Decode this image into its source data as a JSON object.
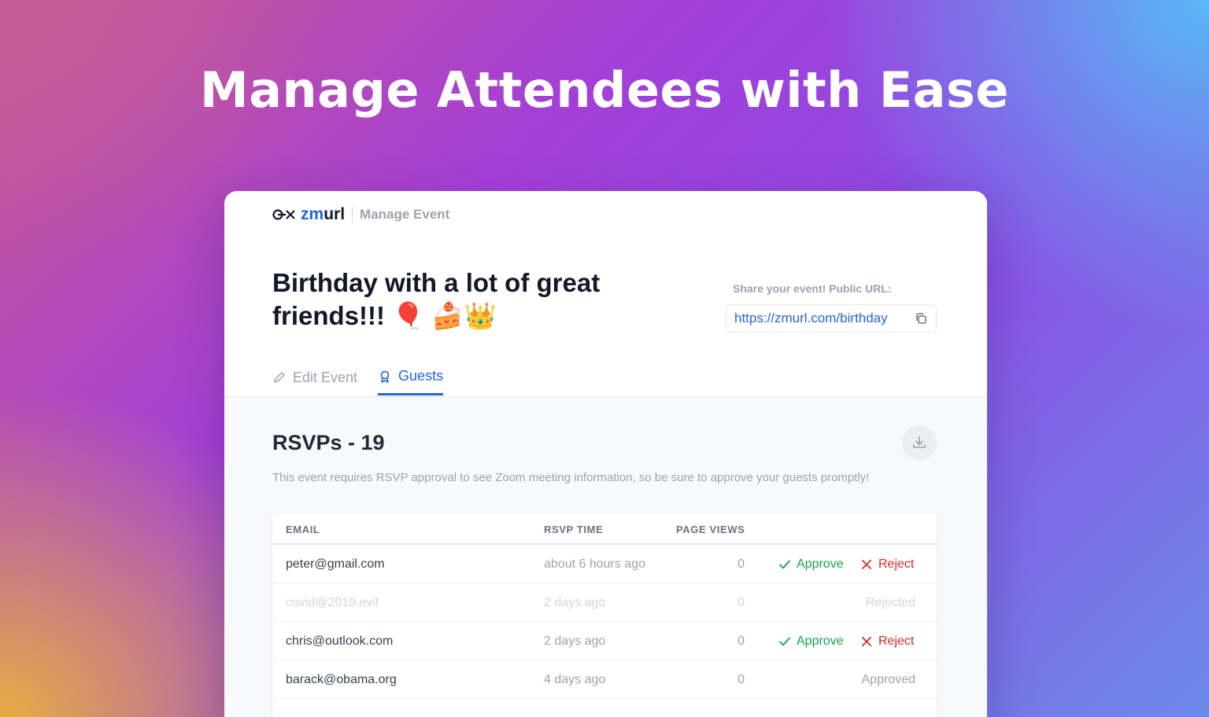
{
  "headline": "Manage Attendees with Ease",
  "app": {
    "logo_prefix": "zm",
    "logo_suffix": "url",
    "crumb": "Manage Event"
  },
  "event": {
    "title": "Birthday with a lot of great friends!!! 🎈 🍰👑",
    "share_label": "Share your event! Public URL:",
    "share_url": "https://zmurl.com/birthday"
  },
  "tabs": [
    {
      "label": "Edit Event",
      "icon": "pencil-icon",
      "active": false
    },
    {
      "label": "Guests",
      "icon": "badge-icon",
      "active": true
    }
  ],
  "rsvps": {
    "title": "RSVPs - 19",
    "note": "This event requires RSVP approval to see Zoom meeting information, so be sure to approve your guests promptly!",
    "columns": {
      "email": "EMAIL",
      "time": "RSVP TIME",
      "views": "PAGE VIEWS"
    },
    "approve_label": "Approve",
    "reject_label": "Reject",
    "rows": [
      {
        "email": "peter@gmail.com",
        "time": "about 6 hours ago",
        "views": "0",
        "status": ""
      },
      {
        "email": "covid@2019.evil",
        "time": "2 days ago",
        "views": "0",
        "status": "Rejected"
      },
      {
        "email": "chris@outlook.com",
        "time": "2 days ago",
        "views": "0",
        "status": ""
      },
      {
        "email": "barack@obama.org",
        "time": "4 days ago",
        "views": "0",
        "status": "Approved"
      }
    ]
  },
  "colors": {
    "accent": "#2563eb",
    "approve": "#16a34a",
    "reject": "#dc2626"
  }
}
